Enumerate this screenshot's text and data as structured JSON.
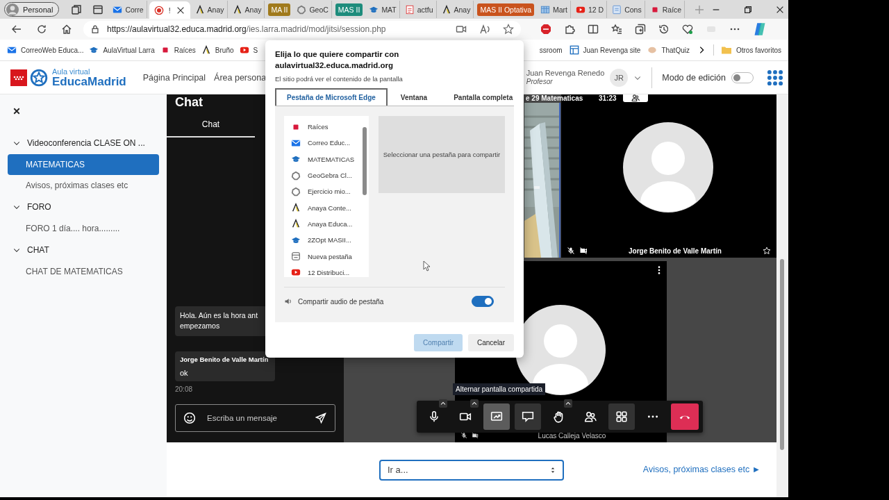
{
  "browser": {
    "profile": "Personal",
    "tabs": [
      {
        "kind": "tab",
        "label": "Corre",
        "selected": false
      },
      {
        "kind": "tab",
        "label": "!",
        "selected": true
      },
      {
        "kind": "tab",
        "label": "Anay",
        "selected": false
      },
      {
        "kind": "tab",
        "label": "Anay",
        "selected": false
      },
      {
        "kind": "group",
        "label": "MA II",
        "color": "#a07a1c"
      },
      {
        "kind": "tab",
        "label": "GeoC",
        "selected": false
      },
      {
        "kind": "group",
        "label": "MAS II",
        "color": "#1e8c7c"
      },
      {
        "kind": "tab",
        "label": "MAT",
        "selected": false
      },
      {
        "kind": "tab",
        "label": "actfu",
        "selected": false
      },
      {
        "kind": "tab",
        "label": "Anay",
        "selected": false
      },
      {
        "kind": "group",
        "label": "MAS II Optativa",
        "color": "#c9531d"
      },
      {
        "kind": "tab",
        "label": "Mart",
        "selected": false
      },
      {
        "kind": "tab",
        "label": "12 D",
        "selected": false
      },
      {
        "kind": "tab",
        "label": "Cons",
        "selected": false
      },
      {
        "kind": "tab",
        "label": "Raíce",
        "selected": false
      }
    ],
    "url_host": "https://aulavirtual32.educa.madrid.org",
    "url_path": "/ies.larra.madrid/mod/jitsi/session.php",
    "favorites_left": [
      "CorreoWeb Educa...",
      "AulaVirtual Larra",
      "Raíces",
      "Bruño",
      "S"
    ],
    "favorites_right": [
      "ssroom",
      "Juan Revenga site",
      "ThatQuiz"
    ],
    "other_favorites": "Otros favoritos"
  },
  "header": {
    "brand_tagline": "Aula virtual",
    "brand_name": "EducaMadrid",
    "nav": [
      "Página Principal",
      "Área persona"
    ],
    "user_name": "Juan Revenga Renedo",
    "user_role": "Profesor",
    "avatar": "JR",
    "edit_mode": {
      "label": "Modo de edición",
      "on": false
    }
  },
  "sidebar": {
    "items": [
      {
        "label": "Videoconferencia CLASE ON ...",
        "expanded": true,
        "children": [
          {
            "label": "MATEMATICAS",
            "selected": true
          },
          {
            "label": "Avisos, próximas clases etc",
            "selected": false
          }
        ]
      },
      {
        "label": "FORO",
        "expanded": true,
        "children": [
          {
            "label": "FORO 1 día.... hora.........",
            "selected": false
          }
        ]
      },
      {
        "label": "CHAT",
        "expanded": true,
        "children": [
          {
            "label": "CHAT DE MATEMATICAS",
            "selected": false
          }
        ]
      }
    ]
  },
  "chat": {
    "title": "Chat",
    "tabs": [
      {
        "label": "Chat",
        "selected": true
      }
    ],
    "messages": [
      {
        "kind": "plain",
        "text": "Hola. Aún es la hora ant\nempezamos"
      },
      {
        "kind": "named",
        "author": "Jorge Benito de Valle Martín",
        "text": "ok",
        "time": "20:08"
      }
    ],
    "input_placeholder": "Escriba un mensaje"
  },
  "meeting": {
    "subject": "e 29 Matematicas",
    "timer": "31:23",
    "tiles": [
      {
        "name": "Jorge Benito de Valle Martín"
      },
      {
        "name": "Lucas Calleja Velasco"
      }
    ],
    "tooltip": "Alternar pantalla compartida",
    "toolbar": [
      {
        "kind": "mic",
        "caret": true,
        "selected": false,
        "toggled": false
      },
      {
        "kind": "camera",
        "caret": true,
        "selected": false,
        "toggled": false
      },
      {
        "kind": "screenshare",
        "caret": false,
        "selected": true,
        "toggled": true
      },
      {
        "kind": "chat",
        "caret": false,
        "selected": false,
        "toggled": true
      },
      {
        "kind": "hand",
        "caret": true,
        "selected": false,
        "toggled": false
      },
      {
        "kind": "participants",
        "caret": false,
        "selected": false,
        "toggled": false
      },
      {
        "kind": "tiles",
        "caret": false,
        "selected": false,
        "toggled": true
      },
      {
        "kind": "more",
        "caret": false,
        "selected": false,
        "toggled": false
      },
      {
        "kind": "hangup",
        "caret": false
      }
    ]
  },
  "footer": {
    "jump_value": "Ir a...",
    "next_link": "Avisos, próximas clases etc ►"
  },
  "dialog": {
    "title": "Elija lo que quiere compartir con aulavirtual32.educa.madrid.org",
    "subtitle": "El sitio podrá ver el contenido de la pantalla",
    "tabs": [
      {
        "label": "Pestaña de Microsoft Edge",
        "selected": true
      },
      {
        "label": "Ventana",
        "selected": false
      },
      {
        "label": "Pantalla completa",
        "selected": false
      }
    ],
    "sources": [
      "Raíces",
      "Correo Educ...",
      "MATEMATICAS",
      "GeoGebra Cl...",
      "Ejercicio mio...",
      "Anaya Conte...",
      "Anaya Educa...",
      "2ZOpt MASII...",
      "Nueva pestaña",
      "12 Distribuci..."
    ],
    "preview_hint": "Seleccionar una pestaña para compartir",
    "audio": {
      "label": "Compartir audio de pestaña",
      "on": true
    },
    "buttons": [
      {
        "label": "Compartir",
        "disabled": true
      },
      {
        "label": "Cancelar",
        "disabled": false
      }
    ]
  }
}
